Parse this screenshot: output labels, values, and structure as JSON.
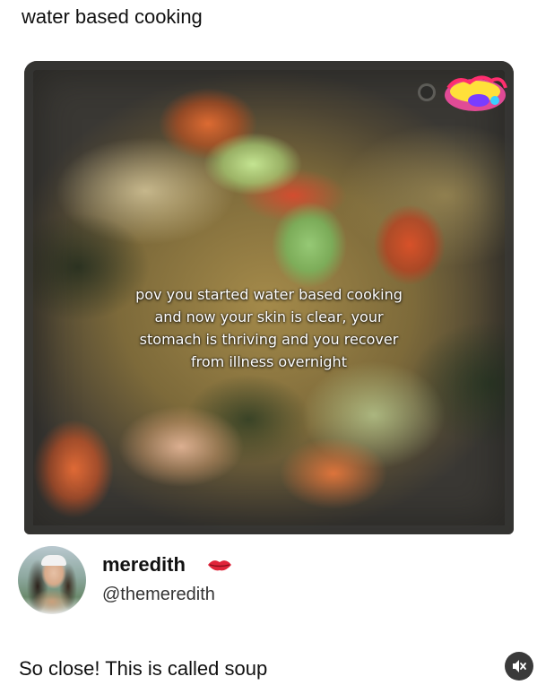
{
  "caption": "water based cooking",
  "media": {
    "overlay_lines": [
      "pov you started water based cooking",
      "and now your skin is clear, your",
      "stomach is thriving and you recover",
      "from illness overnight"
    ],
    "sticker_icon": "cooking-sticker-icon"
  },
  "author": {
    "name": "meredith",
    "handle": "@themeredith",
    "emoji_icon": "lips-icon"
  },
  "reply": "So close! This is called soup",
  "controls": {
    "mute_icon": "speaker-muted-icon",
    "mute_color": "#3a3a3a"
  }
}
